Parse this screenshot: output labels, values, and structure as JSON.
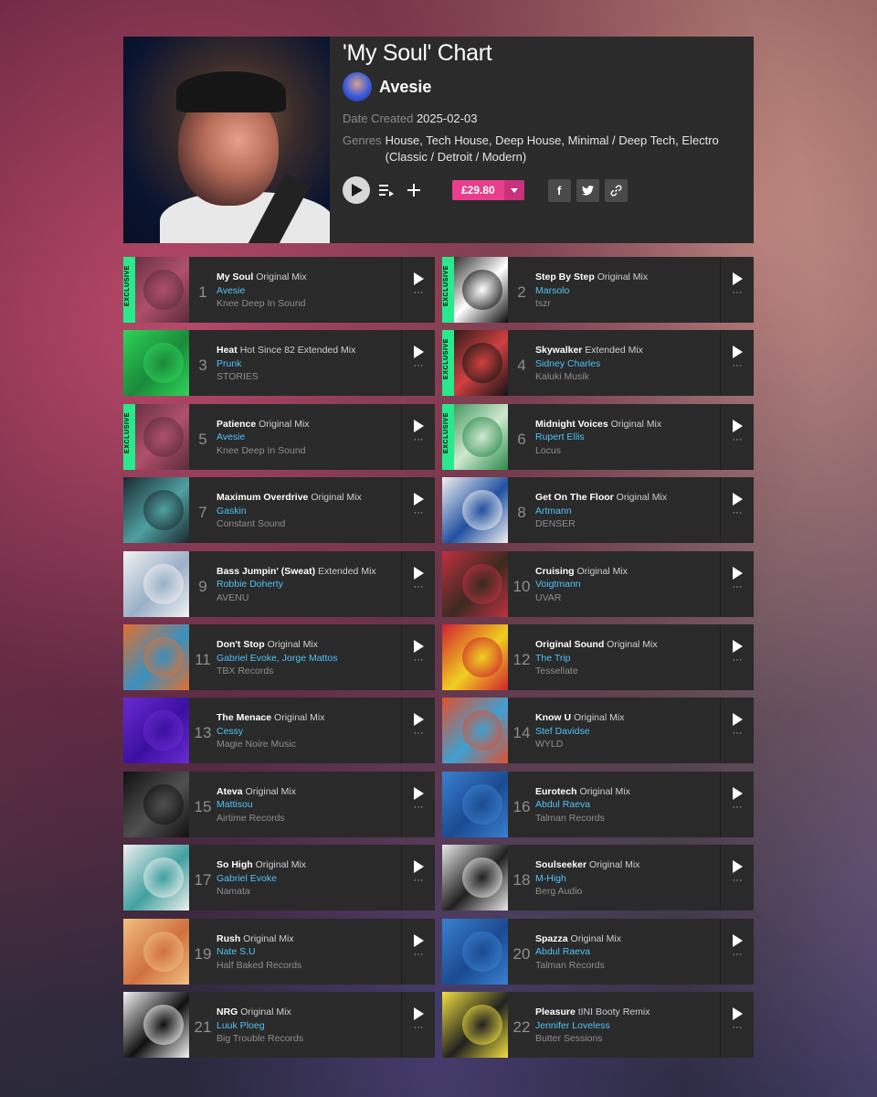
{
  "chart": {
    "title": "'My Soul' Chart",
    "artist": "Avesie",
    "date_label": "Date Created",
    "date_value": "2025-02-03",
    "genres_label": "Genres",
    "genres_value": "House, Tech House, Deep House, Minimal / Deep Tech, Electro (Classic / Detroit / Modern)",
    "price": "£29.80",
    "icons": [
      "play-icon",
      "add-to-queue-icon",
      "plus-icon",
      "chevron-down-icon",
      "facebook-icon",
      "twitter-icon",
      "link-icon"
    ]
  },
  "exclusive_label": "EXCLUSIVE",
  "tracks": [
    {
      "num": "1",
      "title": "My Soul",
      "mix": "Original Mix",
      "artist": "Avesie",
      "label": "Knee Deep In Sound",
      "exclusive": true,
      "art": [
        "#5a2c3c",
        "#b0506a"
      ]
    },
    {
      "num": "2",
      "title": "Step By Step",
      "mix": "Original Mix",
      "artist": "Marsolo",
      "label": "tszr",
      "exclusive": true,
      "art": [
        "#0b0b0b",
        "#ffffff"
      ]
    },
    {
      "num": "3",
      "title": "Heat",
      "mix": "Hot Since 82 Extended Mix",
      "artist": "Prunk",
      "label": "STORIES",
      "exclusive": false,
      "art": [
        "#2fd45a",
        "#1a8a3a"
      ]
    },
    {
      "num": "4",
      "title": "Skywalker",
      "mix": "Extended Mix",
      "artist": "Sidney Charles",
      "label": "Kaluki Musik",
      "exclusive": true,
      "art": [
        "#141414",
        "#d04040"
      ]
    },
    {
      "num": "5",
      "title": "Patience",
      "mix": "Original Mix",
      "artist": "Avesie",
      "label": "Knee Deep In Sound",
      "exclusive": true,
      "art": [
        "#5a2c3c",
        "#b0506a"
      ]
    },
    {
      "num": "6",
      "title": "Midnight Voices",
      "mix": "Original Mix",
      "artist": "Rupert Ellis",
      "label": "Locus",
      "exclusive": true,
      "art": [
        "#2a8a4a",
        "#cfe8d0"
      ]
    },
    {
      "num": "7",
      "title": "Maximum Overdrive",
      "mix": "Original Mix",
      "artist": "Gaskin",
      "label": "Constant Sound",
      "exclusive": false,
      "art": [
        "#1a2a30",
        "#4fa0a0"
      ]
    },
    {
      "num": "8",
      "title": "Get On The Floor",
      "mix": "Original Mix",
      "artist": "Artmann",
      "label": "DENSER",
      "exclusive": false,
      "art": [
        "#f0f0f0",
        "#2050a0"
      ]
    },
    {
      "num": "9",
      "title": "Bass Jumpin' (Sweat)",
      "mix": "Extended Mix",
      "artist": "Robbie Doherty",
      "label": "AVENU",
      "exclusive": false,
      "art": [
        "#f2f2f2",
        "#9ab0c8"
      ]
    },
    {
      "num": "10",
      "title": "Cruising",
      "mix": "Original Mix",
      "artist": "Voigtmann",
      "label": "UVAR",
      "exclusive": false,
      "art": [
        "#c03040",
        "#3a2a20"
      ]
    },
    {
      "num": "11",
      "title": "Don't Stop",
      "mix": "Original Mix",
      "artist": "Gabriel Evoke, Jorge Mattos",
      "label": "TBX Records",
      "exclusive": false,
      "art": [
        "#e07030",
        "#3a90c0"
      ]
    },
    {
      "num": "12",
      "title": "Original Sound",
      "mix": "Original Mix",
      "artist": "The Trip",
      "label": "Tessellate",
      "exclusive": false,
      "art": [
        "#d02030",
        "#f0d020"
      ]
    },
    {
      "num": "13",
      "title": "The Menace",
      "mix": "Original Mix",
      "artist": "Cessy",
      "label": "Magie Noire Music",
      "exclusive": false,
      "art": [
        "#6a2ad0",
        "#3a10a0"
      ]
    },
    {
      "num": "14",
      "title": "Know U",
      "mix": "Original Mix",
      "artist": "Stef Davidse",
      "label": "WYLD",
      "exclusive": false,
      "art": [
        "#e05030",
        "#40a0d0"
      ]
    },
    {
      "num": "15",
      "title": "Ateva",
      "mix": "Original Mix",
      "artist": "Mattisou",
      "label": "Airtime Records",
      "exclusive": false,
      "art": [
        "#101010",
        "#505050"
      ]
    },
    {
      "num": "16",
      "title": "Eurotech",
      "mix": "Original Mix",
      "artist": "Abdul Raeva",
      "label": "Talman Records",
      "exclusive": false,
      "art": [
        "#3a80d0",
        "#1a4a90"
      ]
    },
    {
      "num": "17",
      "title": "So High",
      "mix": "Original Mix",
      "artist": "Gabriel Evoke",
      "label": "Namata",
      "exclusive": false,
      "art": [
        "#f0f0f0",
        "#40a0a0"
      ]
    },
    {
      "num": "18",
      "title": "Soulseeker",
      "mix": "Original Mix",
      "artist": "M-High",
      "label": "Berg Audio",
      "exclusive": false,
      "art": [
        "#e8e8e8",
        "#202020"
      ]
    },
    {
      "num": "19",
      "title": "Rush",
      "mix": "Original Mix",
      "artist": "Nate S.U",
      "label": "Half Baked Records",
      "exclusive": false,
      "art": [
        "#f0c080",
        "#d07040"
      ]
    },
    {
      "num": "20",
      "title": "Spazza",
      "mix": "Original Mix",
      "artist": "Abdul Raeva",
      "label": "Talman Records",
      "exclusive": false,
      "art": [
        "#3a80d0",
        "#1a4a90"
      ]
    },
    {
      "num": "21",
      "title": "NRG",
      "mix": "Original Mix",
      "artist": "Luuk Ploeg",
      "label": "Big Trouble Records",
      "exclusive": false,
      "art": [
        "#f4f4f4",
        "#101010"
      ]
    },
    {
      "num": "22",
      "title": "Pleasure",
      "mix": "tINI Booty Remix",
      "artist": "Jennifer Loveless",
      "label": "Butter Sessions",
      "exclusive": false,
      "art": [
        "#f2e040",
        "#202020"
      ]
    }
  ]
}
